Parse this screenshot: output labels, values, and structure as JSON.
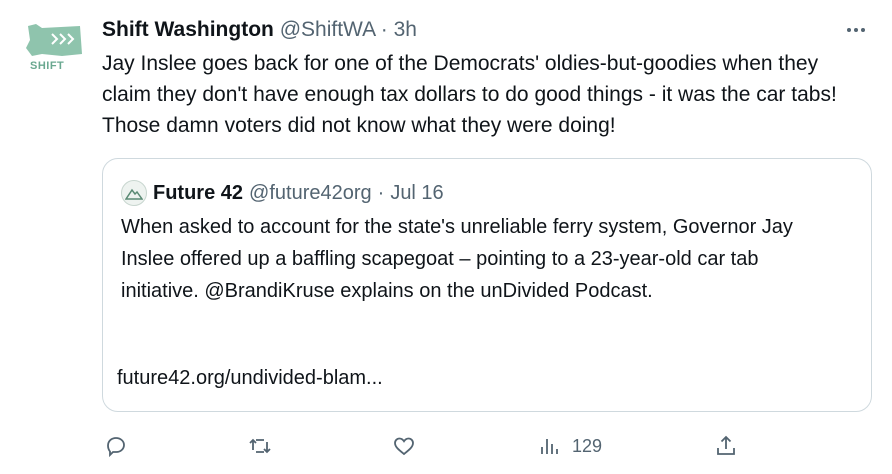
{
  "tweet": {
    "avatar_label": "SHIFT",
    "name": "Shift Washington",
    "handle": "@ShiftWA",
    "separator": "·",
    "time": "3h",
    "text": "Jay Inslee goes back for one of the Democrats' oldies-but-goodies when they claim they don't have enough tax dollars to do good things - it was the car tabs!  Those damn voters did not know what they were doing!"
  },
  "quote": {
    "name": "Future 42",
    "handle": "@future42org",
    "separator": "·",
    "time": "Jul 16",
    "text": "When asked to account for the state's unreliable ferry system, Governor Jay Inslee offered up a baffling scapegoat – pointing to a 23-year-old car tab initiative. @BrandiKruse explains on the unDivided Podcast.",
    "link": "future42.org/undivided-blam..."
  },
  "actions": {
    "reply_icon": "reply-icon",
    "retweet_icon": "retweet-icon",
    "like_icon": "heart-icon",
    "views_icon": "views-icon",
    "views_count": "129",
    "share_icon": "share-icon"
  },
  "colors": {
    "text": "#0f1419",
    "secondary": "#536471",
    "border": "#cfd9de",
    "brand": "#6aa890"
  }
}
